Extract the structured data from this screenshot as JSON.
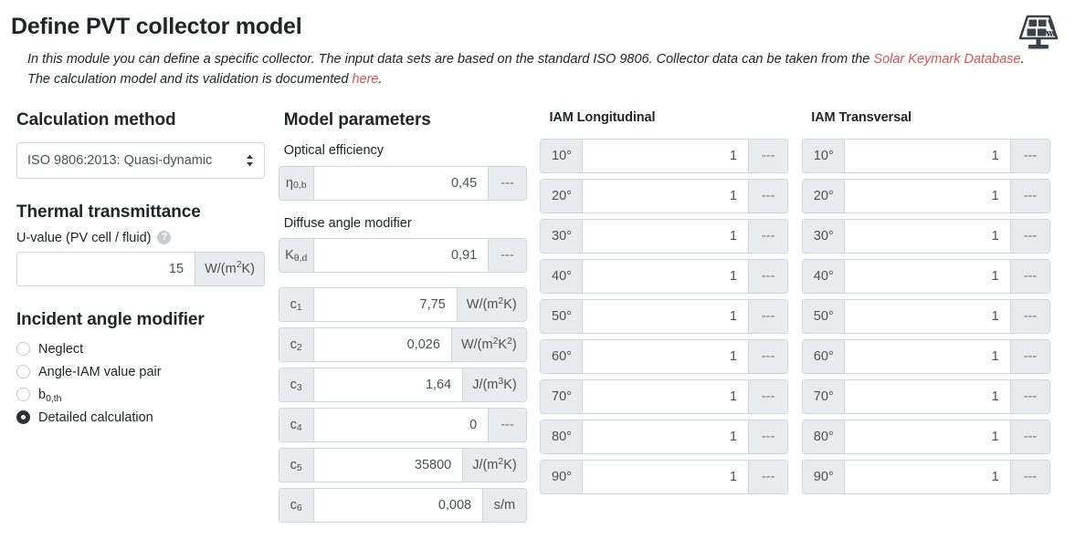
{
  "header": {
    "title": "Define PVT collector model",
    "intro_part1": "In this module you can define a specific collector. The input data sets are based on the standard ISO 9806. Collector data can be taken from the ",
    "intro_link1": "Solar Keymark Database",
    "intro_part2": ". The calculation model and its validation is documented ",
    "intro_link2": "here",
    "intro_part3": ".",
    "icon": "solar-panel-icon",
    "link_color": "#d9534f"
  },
  "calculation_method": {
    "heading": "Calculation method",
    "selected": "ISO 9806:2013: Quasi-dynamic",
    "options": [
      "ISO 9806:2013: Quasi-dynamic"
    ]
  },
  "thermal_transmittance": {
    "heading": "Thermal transmittance",
    "label": "U-value (PV cell / fluid)",
    "help": "?",
    "value": "15",
    "unit_prefix": "W/(m",
    "unit_sup": "2",
    "unit_suffix": "K)"
  },
  "incident_angle_modifier": {
    "heading": "Incident angle modifier",
    "options": [
      {
        "label": "Neglect",
        "selected": false
      },
      {
        "label": "Angle-IAM value pair",
        "selected": false
      },
      {
        "label": "b0,th",
        "label_base": "b",
        "label_sub": "0,th",
        "selected": false
      },
      {
        "label": "Detailed calculation",
        "selected": true
      }
    ]
  },
  "model_parameters": {
    "heading": "Model parameters",
    "optical_efficiency_label": "Optical efficiency",
    "optical_efficiency": {
      "symbol_base": "η",
      "symbol_sub": "0,b",
      "value": "0,45",
      "unit": "---"
    },
    "diffuse_angle_label": "Diffuse angle modifier",
    "diffuse_angle": {
      "symbol_base": "K",
      "symbol_sub": "θ,d",
      "value": "0,91",
      "unit": "---"
    },
    "coefficients": [
      {
        "symbol_base": "c",
        "symbol_sub": "1",
        "value": "7,75",
        "unit_pre": "W/(m",
        "unit_sup": "2",
        "unit_post": "K)",
        "unit_plain": null,
        "width": "w-unit1"
      },
      {
        "symbol_base": "c",
        "symbol_sub": "2",
        "value": "0,026",
        "unit_pre": "W/(m",
        "unit_sup": "2",
        "unit_post": "K",
        "unit_sup2": "2",
        "unit_post2": ")",
        "unit_plain": null,
        "width": "w-unit2"
      },
      {
        "symbol_base": "c",
        "symbol_sub": "3",
        "value": "1,64",
        "unit_pre": "J/(m",
        "unit_sup": "3",
        "unit_post": "K)",
        "unit_plain": null,
        "width": "w-unit1"
      },
      {
        "symbol_base": "c",
        "symbol_sub": "4",
        "value": "0",
        "unit_plain": "---",
        "width": "w-dash"
      },
      {
        "symbol_base": "c",
        "symbol_sub": "5",
        "value": "35800",
        "unit_pre": "J/(m",
        "unit_sup": "2",
        "unit_post": "K)",
        "unit_plain": null,
        "width": "w-unit1"
      },
      {
        "symbol_base": "c",
        "symbol_sub": "6",
        "value": "0,008",
        "unit_plain": "s/m",
        "width": "w-unit3"
      }
    ]
  },
  "iam_longitudinal": {
    "heading": "IAM Longitudinal",
    "rows": [
      {
        "angle": "10°",
        "value": "1",
        "unit": "---"
      },
      {
        "angle": "20°",
        "value": "1",
        "unit": "---"
      },
      {
        "angle": "30°",
        "value": "1",
        "unit": "---"
      },
      {
        "angle": "40°",
        "value": "1",
        "unit": "---"
      },
      {
        "angle": "50°",
        "value": "1",
        "unit": "---"
      },
      {
        "angle": "60°",
        "value": "1",
        "unit": "---"
      },
      {
        "angle": "70°",
        "value": "1",
        "unit": "---"
      },
      {
        "angle": "80°",
        "value": "1",
        "unit": "---"
      },
      {
        "angle": "90°",
        "value": "1",
        "unit": "---"
      }
    ]
  },
  "iam_transversal": {
    "heading": "IAM Transversal",
    "rows": [
      {
        "angle": "10°",
        "value": "1",
        "unit": "---"
      },
      {
        "angle": "20°",
        "value": "1",
        "unit": "---"
      },
      {
        "angle": "30°",
        "value": "1",
        "unit": "---"
      },
      {
        "angle": "40°",
        "value": "1",
        "unit": "---"
      },
      {
        "angle": "50°",
        "value": "1",
        "unit": "---"
      },
      {
        "angle": "60°",
        "value": "1",
        "unit": "---"
      },
      {
        "angle": "70°",
        "value": "1",
        "unit": "---"
      },
      {
        "angle": "80°",
        "value": "1",
        "unit": "---"
      },
      {
        "angle": "90°",
        "value": "1",
        "unit": "---"
      }
    ]
  }
}
